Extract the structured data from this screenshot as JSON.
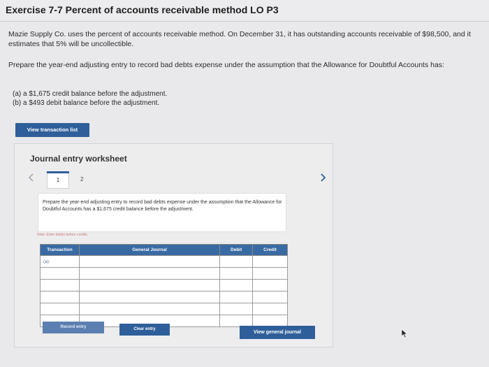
{
  "title": "Exercise 7-7 Percent of accounts receivable method LO P3",
  "problem": {
    "line1": "Mazie Supply Co. uses the percent of accounts receivable method. On December 31, it has outstanding accounts receivable of $98,500, and it estimates that 5% will be uncollectible.",
    "line2": "Prepare the year-end adjusting entry to record bad debts expense under the assumption that the Allowance for Doubtful Accounts has:",
    "option_a": "(a) a $1,675 credit balance before the adjustment.",
    "option_b": "(b) a $493 debit balance before the adjustment."
  },
  "view_transaction_label": "View transaction list",
  "worksheet": {
    "title": "Journal entry worksheet",
    "prev_icon": "chevron-left-icon",
    "next_icon": "chevron-right-icon",
    "pages": [
      "1",
      "2"
    ],
    "instruction": "Prepare the year-end adjusting entry to record bad debts expense under the assumption that the Allowance for Doubtful Accounts has a $1,675 credit balance before the adjustment.",
    "note": "Note: Enter debits before credits.",
    "table": {
      "headers": [
        "Transaction",
        "General Journal",
        "Debit",
        "Credit"
      ],
      "first_transaction": "(a)"
    },
    "record_label": "Record entry",
    "clear_label": "Clear entry",
    "view_journal_label": "View general journal"
  },
  "colors": {
    "accent": "#2f5f9a",
    "header_blue": "#3a6aa3"
  }
}
